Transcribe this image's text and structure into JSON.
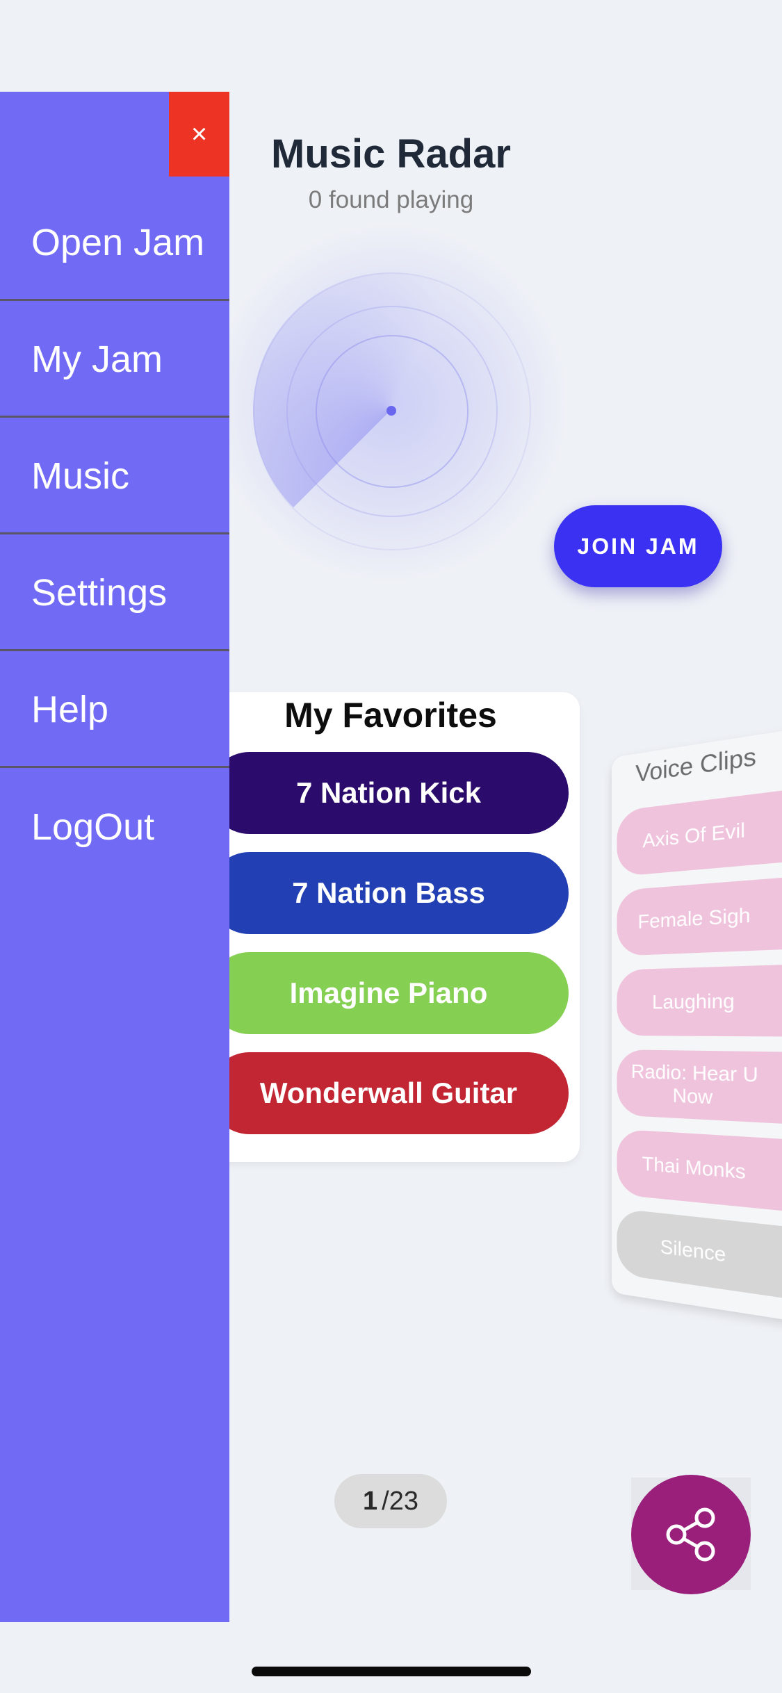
{
  "header": {
    "title": "Music Radar",
    "subtitle": "0 found playing"
  },
  "radar": {
    "icon": "radar-icon"
  },
  "join_button": {
    "label": "JOIN JAM",
    "color": "#3a31f2"
  },
  "favorites": {
    "title": "My Favorites",
    "items": [
      {
        "label": "7 Nation Kick",
        "color": "#2b0b6b"
      },
      {
        "label": "7 Nation Bass",
        "color": "#2240b3"
      },
      {
        "label": "Imagine Piano",
        "color": "#85cf53"
      },
      {
        "label": "Wonderwall Guitar",
        "color": "#c22633"
      }
    ]
  },
  "voice_clips": {
    "title": "Voice Clips",
    "items": [
      {
        "label": "Axis Of Evil",
        "color": "#efc3dc"
      },
      {
        "label": "Female Sigh",
        "color": "#efc3dc"
      },
      {
        "label": "Laughing",
        "color": "#efc3dc"
      },
      {
        "label": "Radio: Hear U Now",
        "color": "#efc3dc"
      },
      {
        "label": "Thai Monks",
        "color": "#efc3dc"
      },
      {
        "label": "Silence",
        "color": "#d6d6d6"
      }
    ]
  },
  "pager": {
    "current": "1",
    "total": "/23"
  },
  "share_button": {
    "icon": "share-icon",
    "color": "#9a1f7a"
  },
  "drawer": {
    "background": "#716af5",
    "close_icon": "close-icon",
    "close_label": "×",
    "items": [
      {
        "label": "Open Jam"
      },
      {
        "label": "My Jam"
      },
      {
        "label": "Music"
      },
      {
        "label": "Settings"
      },
      {
        "label": "Help"
      },
      {
        "label": "LogOut"
      }
    ]
  }
}
